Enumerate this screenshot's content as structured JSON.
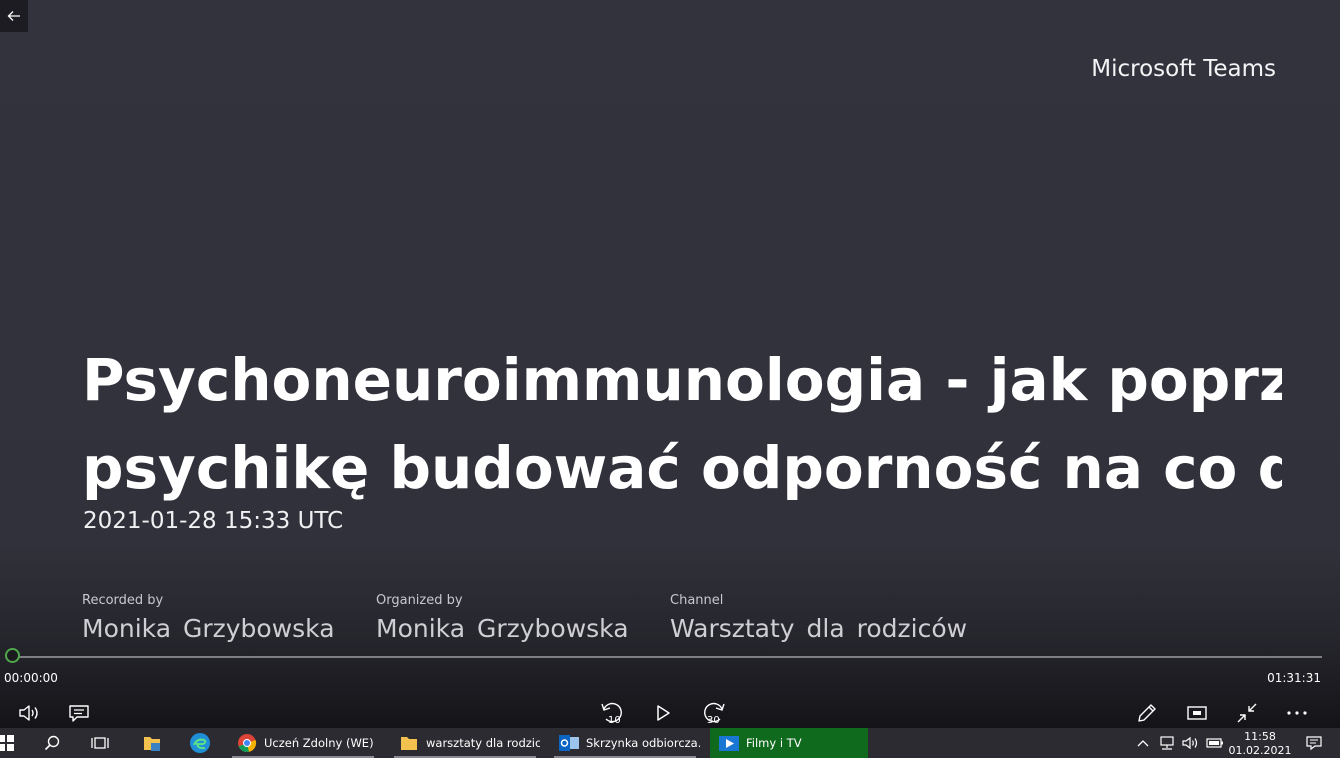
{
  "brand": "Microsoft Teams",
  "meeting": {
    "title_line1": "Psychoneuroimmunologia - jak poprzez",
    "title_line2": "psychikę budować odporność na co d...",
    "datetime": "2021-01-28 15:33 UTC",
    "recorded_by_label": "Recorded by",
    "recorded_by": "Monika  Grzybowska",
    "organized_by_label": "Organized by",
    "organized_by": "Monika  Grzybowska",
    "channel_label": "Channel",
    "channel": "Warsztaty dla rodziców"
  },
  "player": {
    "current_time": "00:00:00",
    "total_time": "01:31:31",
    "progress": 0,
    "skip_back_label": "10",
    "skip_forward_label": "30",
    "accent_color": "#4fa84a"
  },
  "taskbar": {
    "apps": [
      {
        "label": "Uczeń Zdolny (WE) ...",
        "icon": "chrome-icon"
      },
      {
        "label": "warsztaty dla rodzic...",
        "icon": "folder-icon"
      },
      {
        "label": "Skrzynka odbiorcza...",
        "icon": "outlook-icon"
      },
      {
        "label": "Filmy i TV",
        "icon": "films-tv-icon",
        "active": true
      }
    ],
    "clock_time": "11:58",
    "clock_date": "01.02.2021",
    "active_color": "#0f6a1d"
  }
}
